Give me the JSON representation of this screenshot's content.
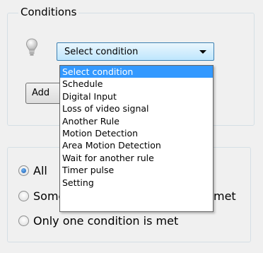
{
  "conditions": {
    "title": "Conditions",
    "select_value": "Select condition",
    "add_button_label": "Add",
    "dropdown_options": [
      "Select condition",
      "Schedule",
      "Digital Input",
      "Loss of video signal",
      "Another Rule",
      "Motion Detection",
      "Area Motion Detection",
      "Wait for another rule",
      "Timer pulse",
      "Setting"
    ],
    "selected_index": 0
  },
  "match": {
    "option_1": "All",
    "option_2_start": "Some",
    "option_2_end": "met",
    "option_3": "Only one condition is met",
    "checked": "option_1"
  },
  "colors": {
    "highlight": "#3399ff",
    "combo_border": "#3c7fb1"
  }
}
